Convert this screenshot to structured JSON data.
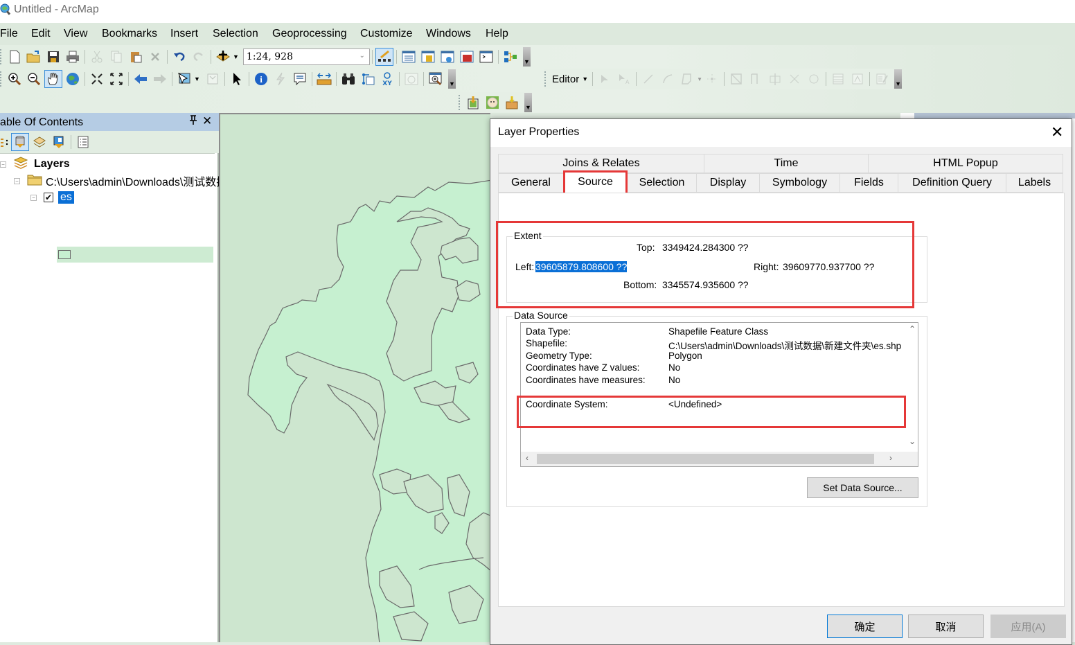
{
  "window": {
    "title": "Untitled - ArcMap"
  },
  "menubar": {
    "items": [
      "File",
      "Edit",
      "View",
      "Bookmarks",
      "Insert",
      "Selection",
      "Geoprocessing",
      "Customize",
      "Windows",
      "Help"
    ]
  },
  "toolbar": {
    "scale_value": "1:24, 928",
    "editor_label": "Editor",
    "standard_icons": [
      "new-document-icon",
      "open-icon",
      "save-icon",
      "print-icon",
      "cut-icon",
      "copy-icon",
      "paste-icon",
      "delete-icon",
      "undo-icon",
      "redo-icon",
      "add-data-icon"
    ],
    "tools_icons": [
      "zoom-in-icon",
      "zoom-out-icon",
      "pan-icon",
      "full-extent-icon",
      "fixed-zoom-in-icon",
      "fixed-zoom-out-icon",
      "back-icon",
      "forward-icon",
      "select-features-icon",
      "clear-selection-icon",
      "select-elements-icon",
      "identify-icon",
      "hyperlink-icon",
      "html-popup-icon",
      "measure-icon",
      "find-icon",
      "find-route-icon",
      "go-to-xy-icon",
      "time-slider-icon",
      "magnifier-icon"
    ]
  },
  "toc": {
    "title": "able Of Contents",
    "pin_glyph": " ",
    "close_glyph": "✕",
    "root_label": "Layers",
    "folder_label": "C:\\Users\\admin\\Downloads\\测试数据",
    "layer_label": "es",
    "layer_checked": true
  },
  "dialog": {
    "title": "Layer Properties",
    "close_glyph": "✕",
    "tabs_row1": [
      "Joins & Relates",
      "Time",
      "HTML Popup"
    ],
    "tabs_row2": [
      "General",
      "Source",
      "Selection",
      "Display",
      "Symbology",
      "Fields",
      "Definition Query",
      "Labels"
    ],
    "selected_tab": "Source",
    "extent": {
      "group_label": "Extent",
      "top_label": "Top:",
      "top_value": "3349424.284300 ??",
      "left_label": "Left:",
      "left_value": "39605879.808600 ??",
      "right_label": "Right:",
      "right_value": "39609770.937700 ??",
      "bottom_label": "Bottom:",
      "bottom_value": "3345574.935600 ??"
    },
    "data_source": {
      "group_label": "Data Source",
      "rows": [
        {
          "label": "Data Type:",
          "value": "Shapefile Feature Class"
        },
        {
          "label": "Shapefile:",
          "value": "C:\\Users\\admin\\Downloads\\测试数据\\新建文件夹\\es.shp"
        },
        {
          "label": "Geometry Type:",
          "value": "Polygon"
        },
        {
          "label": "Coordinates have Z values:",
          "value": "No"
        },
        {
          "label": "Coordinates have measures:",
          "value": "No"
        }
      ],
      "coord_label": "Coordinate System:",
      "coord_value": "<Undefined>"
    },
    "set_data_source_label": "Set Data Source...",
    "ok_label": "确定",
    "cancel_label": "取消",
    "apply_label": "应用(A)"
  },
  "colors": {
    "highlight_red": "#e53838",
    "selection_blue": "#0a6fd6",
    "map_background": "#cde6cf",
    "polygon_fill": "#c6f0d0"
  }
}
